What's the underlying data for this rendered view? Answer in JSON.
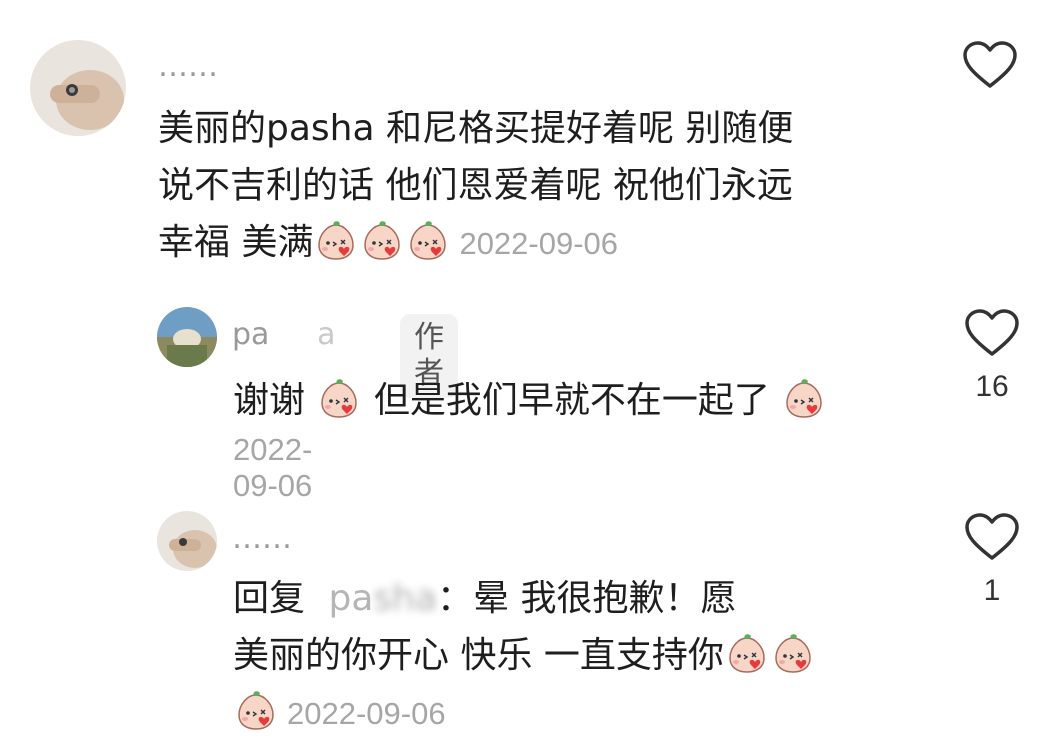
{
  "comments": [
    {
      "username": "……",
      "lines": [
        "美丽的pasha 和尼格买提好着呢 别随便",
        "说不吉利的话 他们恩爱着呢 祝他们永远",
        "幸福 美满"
      ],
      "date": "2022-09-06",
      "likes": ""
    },
    {
      "username": "pa",
      "username_suffix": "a",
      "badge": "作者",
      "text_a": "谢谢",
      "text_b": "但是我们早就不在一起了",
      "date": "2022-09-06",
      "likes": "16"
    },
    {
      "username": "……",
      "reply_prefix": "回复",
      "reply_to": "pa",
      "reply_to_hidden": "sha",
      "line1_rest": "：晕 我很抱歉！愿",
      "line2": "美丽的你开心 快乐 一直支持你",
      "date": "2022-09-06",
      "likes": "1"
    }
  ],
  "icons": {
    "like": "heart-outline-icon",
    "emoji": "peach-kiss-emoji"
  },
  "colors": {
    "text": "#1e1e1e",
    "muted": "#a6a6a6",
    "badge_bg": "#f2f2f2"
  }
}
